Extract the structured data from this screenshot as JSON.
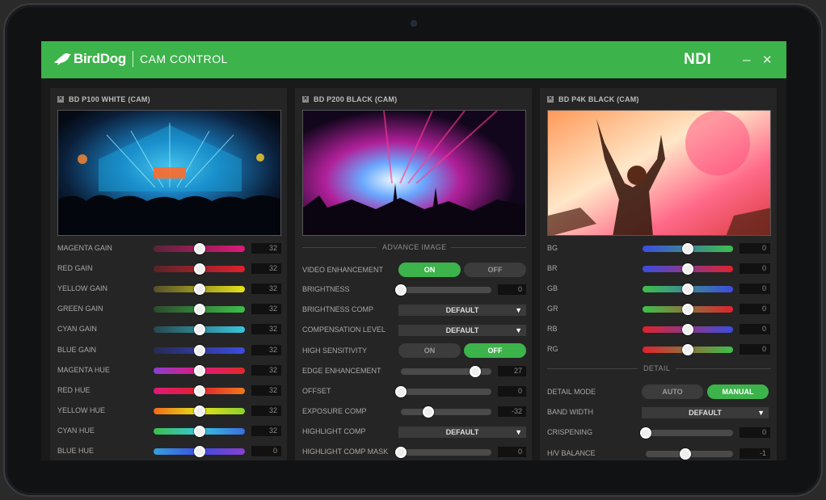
{
  "app": {
    "brand": "BirdDog",
    "title": "CAM CONTROL",
    "ndi": "NDI",
    "minimize": "–",
    "close": "✕"
  },
  "panels": [
    {
      "title": "BD P100 WHITE (CAM)",
      "sliders": [
        {
          "label": "MAGENTA GAIN",
          "value": "32",
          "level": 0.5,
          "gradient": "linear-gradient(90deg,#5a2338,#e0197a)"
        },
        {
          "label": "RED GAIN",
          "value": "32",
          "level": 0.5,
          "gradient": "linear-gradient(90deg,#5a2328,#e0222e)"
        },
        {
          "label": "YELLOW GAIN",
          "value": "32",
          "level": 0.5,
          "gradient": "linear-gradient(90deg,#55502a,#e6e21a)"
        },
        {
          "label": "GREEN GAIN",
          "value": "32",
          "level": 0.5,
          "gradient": "linear-gradient(90deg,#2d4a2c,#3cc04a)"
        },
        {
          "label": "CYAN GAIN",
          "value": "32",
          "level": 0.5,
          "gradient": "linear-gradient(90deg,#284850,#37c6dc)"
        },
        {
          "label": "BLUE GAIN",
          "value": "32",
          "level": 0.5,
          "gradient": "linear-gradient(90deg,#262a55,#3b4de0)"
        },
        {
          "label": "MAGENTA HUE",
          "value": "32",
          "level": 0.5,
          "gradient": "linear-gradient(90deg,#8a3fd0,#e0197a,#e02a2a)"
        },
        {
          "label": "RED HUE",
          "value": "32",
          "level": 0.5,
          "gradient": "linear-gradient(90deg,#e0197a,#e0222e,#f07a1a)"
        },
        {
          "label": "YELLOW HUE",
          "value": "32",
          "level": 0.5,
          "gradient": "linear-gradient(90deg,#f06a1a,#e6e21a,#8ad030)"
        },
        {
          "label": "CYAN HUE",
          "value": "32",
          "level": 0.5,
          "gradient": "linear-gradient(90deg,#3cc04a,#37c6dc,#3b6de0)"
        },
        {
          "label": "BLUE HUE",
          "value": "0",
          "level": 0.5,
          "gradient": "linear-gradient(90deg,#37a0dc,#3b4de0,#8a3fd0)"
        }
      ]
    },
    {
      "title": "BD P200 BLACK (CAM)",
      "section": "ADVANCE IMAGE",
      "rows": [
        {
          "kind": "toggle",
          "label": "VIDEO ENHANCEMENT",
          "on": "ON",
          "off": "OFF",
          "active": "on"
        },
        {
          "kind": "slider",
          "label": "BRIGHTNESS",
          "value": "0",
          "level": 0.0
        },
        {
          "kind": "dropdown",
          "label": "BRIGHTNESS COMP",
          "value": "DEFAULT"
        },
        {
          "kind": "dropdown",
          "label": "COMPENSATION LEVEL",
          "value": "DEFAULT"
        },
        {
          "kind": "toggle",
          "label": "HIGH SENSITIVITY",
          "on": "ON",
          "off": "OFF",
          "active": "off"
        },
        {
          "kind": "slider",
          "label": "EDGE ENHANCEMENT",
          "value": "27",
          "level": 0.82
        },
        {
          "kind": "slider",
          "label": "OFFSET",
          "value": "0",
          "level": 0.0
        },
        {
          "kind": "slider",
          "label": "EXPOSURE COMP",
          "value": "-32",
          "level": 0.3
        },
        {
          "kind": "dropdown",
          "label": "HIGHLIGHT COMP",
          "value": "DEFAULT"
        },
        {
          "kind": "slider",
          "label": "HIGHLIGHT COMP MASK",
          "value": "0",
          "level": 0.0
        }
      ]
    },
    {
      "title": "BD P4K BLACK (CAM)",
      "sliders": [
        {
          "label": "BG",
          "value": "0",
          "level": 0.5,
          "gradient": "linear-gradient(90deg,#3b4de0,#3cc04a)"
        },
        {
          "label": "BR",
          "value": "0",
          "level": 0.5,
          "gradient": "linear-gradient(90deg,#3b4de0,#e0222e)"
        },
        {
          "label": "GB",
          "value": "0",
          "level": 0.5,
          "gradient": "linear-gradient(90deg,#3cc04a,#3b4de0)"
        },
        {
          "label": "GR",
          "value": "0",
          "level": 0.5,
          "gradient": "linear-gradient(90deg,#3cc04a,#e0222e)"
        },
        {
          "label": "RB",
          "value": "0",
          "level": 0.5,
          "gradient": "linear-gradient(90deg,#e0222e,#3b4de0)"
        },
        {
          "label": "RG",
          "value": "0",
          "level": 0.5,
          "gradient": "linear-gradient(90deg,#e0222e,#3cc04a)"
        }
      ],
      "section": "DETAIL",
      "detail": [
        {
          "kind": "toggle",
          "label": "DETAIL MODE",
          "on": "AUTO",
          "off": "MANUAL",
          "active": "off"
        },
        {
          "kind": "dropdown",
          "label": "BAND WIDTH",
          "value": "DEFAULT"
        },
        {
          "kind": "slider",
          "label": "CRISPENING",
          "value": "0",
          "level": 0.0
        },
        {
          "kind": "slider",
          "label": "H/V BALANCE",
          "value": "-1",
          "level": 0.45
        }
      ]
    }
  ],
  "colors": {
    "accent": "#3db34b",
    "panel": "#252525",
    "background": "#1a1a1a"
  }
}
